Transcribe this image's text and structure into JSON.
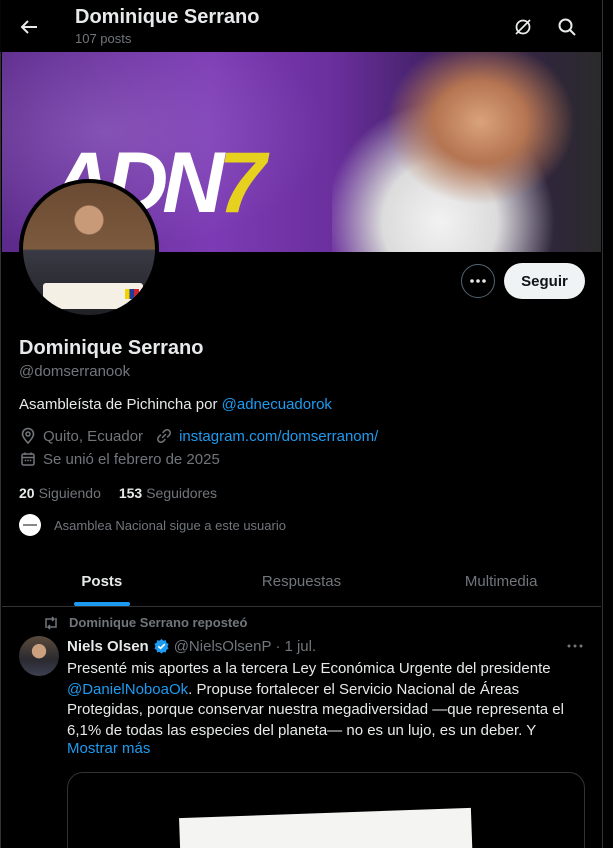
{
  "header": {
    "title": "Dominique Serrano",
    "posts_count": "107 posts"
  },
  "banner": {
    "logo_text": "ADN",
    "logo_number": "7"
  },
  "profile": {
    "name": "Dominique Serrano",
    "handle": "@domserranook",
    "bio_text": "Asambleísta de Pichincha por ",
    "bio_mention": "@adnecuadorok",
    "location": "Quito, Ecuador",
    "website": "instagram.com/domserranom/",
    "joined": "Se unió el febrero de 2025",
    "following_count": "20",
    "following_label": "Siguiendo",
    "followers_count": "153",
    "followers_label": "Seguidores",
    "followed_by": "Asamblea Nacional sigue a este usuario",
    "follow_button": "Seguir"
  },
  "tabs": [
    {
      "label": "Posts",
      "active": true
    },
    {
      "label": "Respuestas",
      "active": false
    },
    {
      "label": "Multimedia",
      "active": false
    }
  ],
  "post": {
    "repost_label": "Dominique Serrano reposteó",
    "author_name": "Niels Olsen",
    "verified": true,
    "author_handle": "@NielsOlsenP",
    "separator": "·",
    "date": "1 jul.",
    "text_before_mention": "Presenté mis aportes a la tercera Ley Económica Urgente del presidente ",
    "mention": "@DanielNoboaOk",
    "text_after_mention": ". Propuse fortalecer el Servicio Nacional de Áreas Protegidas, porque conservar nuestra megadiversidad —que representa el 6,1% de todas las especies del planeta— no es un lujo, es un deber. Y",
    "show_more": "Mostrar más"
  },
  "colors": {
    "accent": "#1d9bf0",
    "background": "#000000",
    "text_primary": "#e7e9ea",
    "text_secondary": "#71767b",
    "banner_purple": "#7c3bb4",
    "banner_yellow": "#e6d21e"
  },
  "icons": {
    "back": "arrow-left-icon",
    "grok": "grok-icon",
    "search": "search-icon",
    "more": "ellipsis-icon",
    "location": "location-pin-icon",
    "link": "link-icon",
    "calendar": "calendar-icon",
    "repost": "repost-icon",
    "verified": "verified-badge-icon"
  }
}
